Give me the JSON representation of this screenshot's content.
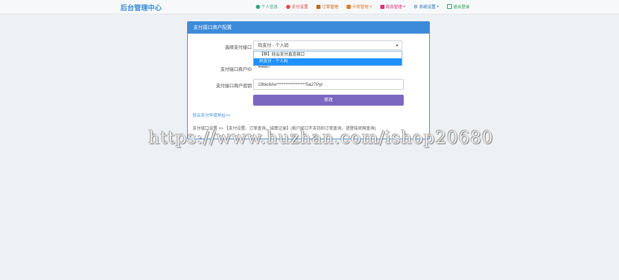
{
  "brand": "后台管理中心",
  "nav": [
    {
      "label": "个人信息",
      "color": "#2aa876",
      "icon": "user-icon",
      "caret": false
    },
    {
      "label": "支付设置",
      "color": "#e04b4b",
      "icon": "cloud-icon",
      "caret": false
    },
    {
      "label": "订单管理",
      "color": "#c86a1a",
      "icon": "list-icon",
      "caret": false
    },
    {
      "label": "卡密管理",
      "color": "#e07a2a",
      "icon": "card-icon",
      "caret": true
    },
    {
      "label": "商品管理",
      "color": "#d6337a",
      "icon": "box-icon",
      "caret": true
    },
    {
      "label": "系统设置",
      "color": "#1c6fb6",
      "icon": "gear-icon",
      "caret": true
    },
    {
      "label": "退出登录",
      "color": "#22a35a",
      "icon": "logout-icon",
      "caret": false
    }
  ],
  "panel": {
    "title": "支付接口商户配置",
    "select": {
      "label": "选择支付接口",
      "value": "码支付 - 个人码",
      "options": [
        "【荐】轻云支付直连接口",
        "码支付 - 个人码"
      ],
      "selected_index": 1
    },
    "merchant_id": {
      "label": "支付接口商户ID",
      "value": "44687"
    },
    "merchant_key": {
      "label": "支付接口商户密钥",
      "value": "19bic8Ae*****************5a27Pyt"
    },
    "submit_label": "修改",
    "note1": "轻云支付申请地址>>",
    "note2": "支付接口设置 >> 【支付设置、订单查询、结算记录】(商户接口不支持的订单查询，请登陆官网查询)"
  },
  "watermark": "https://www.huzhan.com/ishop20680"
}
